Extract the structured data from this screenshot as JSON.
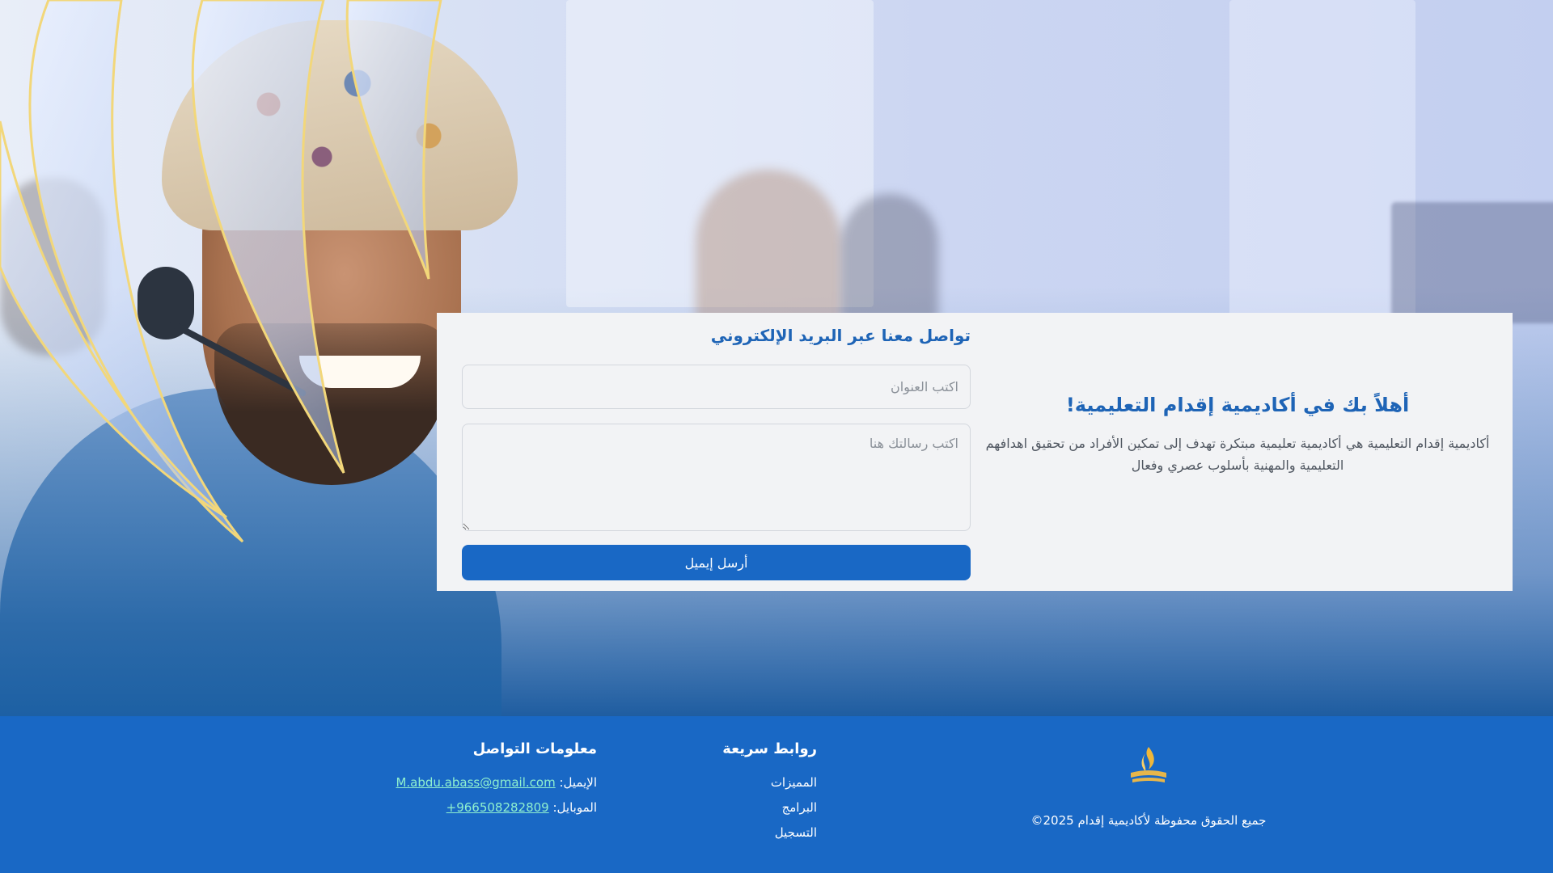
{
  "contact_form": {
    "title": "تواصل معنا عبر البريد الإلكتروني",
    "subject_placeholder": "اكتب العنوان",
    "message_placeholder": "اكتب رسالتك هنا",
    "submit_label": "أرسل إيميل"
  },
  "welcome": {
    "heading": "أهلاً بك في أكاديمية إقدام التعليمية!",
    "description": "أكاديمية إقدام التعليمية هي أكاديمية تعليمية مبتكرة تهدف إلى تمكين الأفراد من تحقيق اهدافهم التعليمية والمهنية بأسلوب عصري وفعال"
  },
  "footer": {
    "copyright": "جميع الحقوق محفوظة لأكاديمية إقدام 2025©",
    "quick_links": {
      "title": "روابط سريعة",
      "items": [
        "المميزات",
        "البرامج",
        "التسجيل"
      ]
    },
    "contact_info": {
      "title": "معلومات التواصل",
      "email_label": "الإيميل:",
      "email_value": "M.abdu.abass@gmail.com",
      "mobile_label": "الموبايل:",
      "mobile_value": "+966508282809"
    }
  },
  "colors": {
    "primary": "#1968c5",
    "heading": "#1e64b6",
    "link_accent": "#8ff0cf",
    "card_bg": "#f2f3f5"
  },
  "icons": {
    "brand": "academy-logo-icon"
  }
}
